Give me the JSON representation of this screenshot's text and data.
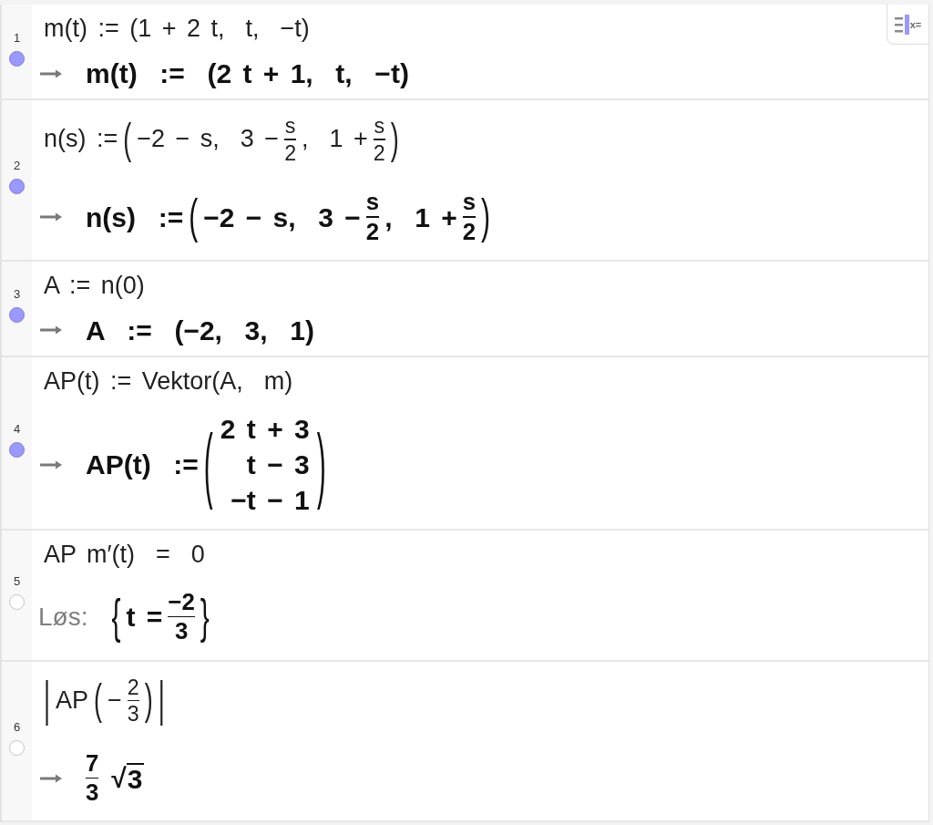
{
  "style_bar_button": {
    "label": "x="
  },
  "rows": [
    {
      "number": "1",
      "visible": true,
      "input": [
        {
          "kind": "text",
          "text": "m(t) := (1 + 2 t,  t,  −t)"
        }
      ],
      "output": {
        "kind": "result",
        "math": [
          {
            "kind": "text",
            "text": "m(t)  :=  (2 t + 1,  t,  −t)"
          }
        ]
      }
    },
    {
      "number": "2",
      "visible": true,
      "input": [
        {
          "kind": "text",
          "text": "n(s) :="
        },
        {
          "kind": "parens",
          "open": "(",
          "close": ")",
          "items": [
            {
              "kind": "text",
              "text": "−2 − s,  3 −"
            },
            {
              "kind": "frac",
              "num": "s",
              "den": "2"
            },
            {
              "kind": "text",
              "text": ",  1 +"
            },
            {
              "kind": "frac",
              "num": "s",
              "den": "2"
            }
          ]
        }
      ],
      "output": {
        "kind": "result",
        "math": [
          {
            "kind": "text",
            "text": "n(s)  :="
          },
          {
            "kind": "parens",
            "open": "(",
            "close": ")",
            "items": [
              {
                "kind": "text",
                "text": "−2 − s,  3 −"
              },
              {
                "kind": "frac",
                "num": "s",
                "den": "2"
              },
              {
                "kind": "text",
                "text": ",  1 +"
              },
              {
                "kind": "frac",
                "num": "s",
                "den": "2"
              }
            ]
          }
        ]
      }
    },
    {
      "number": "3",
      "visible": true,
      "input": [
        {
          "kind": "text",
          "text": "A := n(0)"
        }
      ],
      "output": {
        "kind": "result",
        "math": [
          {
            "kind": "text",
            "text": "A  :=  (−2,  3,  1)"
          }
        ]
      }
    },
    {
      "number": "4",
      "visible": true,
      "input": [
        {
          "kind": "text",
          "text": "AP(t) := Vektor(A,  m)"
        }
      ],
      "output": {
        "kind": "result",
        "math": [
          {
            "kind": "text",
            "text": "AP(t)  :="
          },
          {
            "kind": "parens",
            "open": "(",
            "close": ")",
            "items": [
              {
                "kind": "column",
                "rows": [
                  "2 t + 3",
                  "t − 3",
                  "−t − 1"
                ]
              }
            ]
          }
        ]
      }
    },
    {
      "number": "5",
      "visible": false,
      "input": [
        {
          "kind": "text",
          "text": "AP m′(t)  =  0"
        }
      ],
      "output": {
        "kind": "solve",
        "label": "Løs:",
        "math": [
          {
            "kind": "braces",
            "open": "{",
            "close": "}",
            "items": [
              {
                "kind": "text",
                "text": "t ="
              },
              {
                "kind": "frac",
                "num": "−2",
                "den": "3"
              }
            ]
          }
        ]
      }
    },
    {
      "number": "6",
      "visible": false,
      "input": [
        {
          "kind": "abs",
          "open": "|",
          "close": "|",
          "items": [
            {
              "kind": "text",
              "text": "AP"
            },
            {
              "kind": "parens",
              "open": "(",
              "close": ")",
              "items": [
                {
                  "kind": "text",
                  "text": "−"
                },
                {
                  "kind": "frac",
                  "num": "2",
                  "den": "3"
                }
              ]
            }
          ]
        }
      ],
      "output": {
        "kind": "result",
        "math": [
          {
            "kind": "frac",
            "num": "7",
            "den": "3"
          },
          {
            "kind": "sqrt",
            "sign": "√",
            "radicand": "3"
          }
        ]
      }
    }
  ]
}
